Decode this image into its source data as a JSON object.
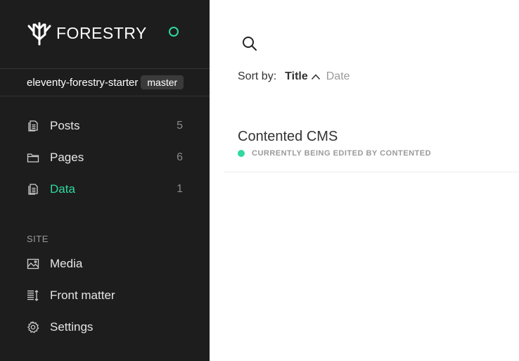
{
  "app": {
    "brand": "FORESTRY",
    "accent_color": "#2fd9a0",
    "status_icon": "status-ring-icon"
  },
  "repo": {
    "name": "eleventy-forestry-starter",
    "branch": "master"
  },
  "sidebar": {
    "content_items": [
      {
        "label": "Posts",
        "count": "5",
        "icon": "documents-icon",
        "active": false
      },
      {
        "label": "Pages",
        "count": "6",
        "icon": "folder-icon",
        "active": false
      },
      {
        "label": "Data",
        "count": "1",
        "icon": "documents-icon",
        "active": true
      }
    ],
    "site_section_label": "SITE",
    "site_items": [
      {
        "label": "Media",
        "icon": "image-icon"
      },
      {
        "label": "Front matter",
        "icon": "front-matter-icon"
      },
      {
        "label": "Settings",
        "icon": "gear-icon"
      }
    ]
  },
  "main": {
    "search_icon": "search-icon",
    "sort": {
      "label": "Sort by:",
      "options": [
        "Title",
        "Date"
      ],
      "active": "Title",
      "direction": "ascending"
    },
    "documents": [
      {
        "title": "Contented CMS",
        "status": "CURRENTLY BEING EDITED BY CONTENTED"
      }
    ]
  }
}
